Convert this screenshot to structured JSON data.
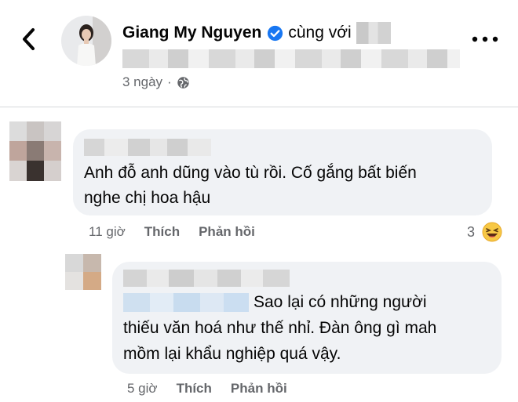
{
  "post": {
    "poster_name": "Giang My Nguyen",
    "with_text": "cùng với",
    "time": "3 ngày",
    "separator": "·"
  },
  "comments": [
    {
      "text_line1": "Anh đỗ anh dũng vào tù rồi. Cố gắng bất biến",
      "text_line2": "nghe chị hoa hậu",
      "time": "11 giờ",
      "like_label": "Thích",
      "reply_label": "Phản hồi",
      "reaction_count": "3",
      "reaction_icon": "laughing-emoji"
    },
    {
      "text_line1": "Sao lại có những người",
      "text_line2": "thiếu văn hoá như thế nhỉ. Đàn ông gì mah",
      "text_line3": "mồm lại khẩu nghiệp quá vậy.",
      "time": "5 giờ",
      "like_label": "Thích",
      "reply_label": "Phản hồi"
    }
  ],
  "colors": {
    "verified_blue": "#1877f2",
    "meta_gray": "#65676b",
    "bubble_bg": "#f0f2f5",
    "text": "#050505"
  },
  "icons": [
    "back-arrow-icon",
    "verified-badge-icon",
    "globe-icon",
    "more-options-icon",
    "laughing-emoji-icon"
  ]
}
